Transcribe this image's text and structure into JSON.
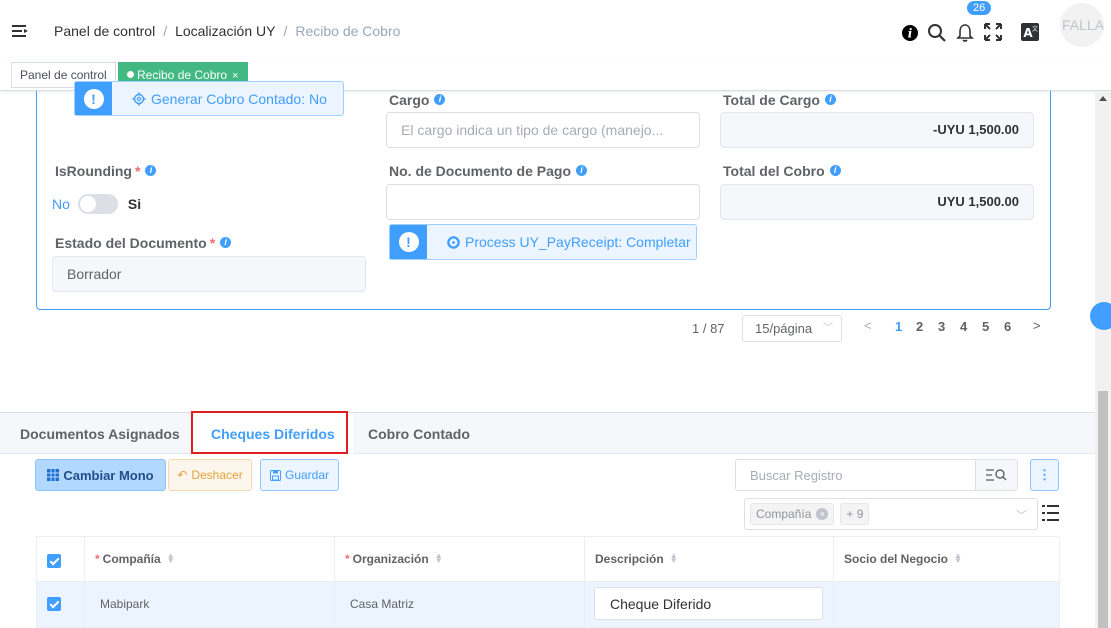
{
  "header": {
    "breadcrumbs": [
      "Panel de control",
      "Localización UY",
      "Recibo de Cobro"
    ],
    "notification_count": "26",
    "avatar_text": "FALLA"
  },
  "tags": {
    "items": [
      {
        "label": "Panel de control"
      },
      {
        "label": "Recibo de Cobro",
        "close": "×"
      }
    ]
  },
  "form": {
    "generar_cobro_btn": "Generar Cobro Contado: No",
    "cargo_label": "Cargo",
    "cargo_placeholder": "El cargo indica un tipo de cargo (manejo...",
    "total_cargo_label": "Total de Cargo",
    "total_cargo_value": "-UYU 1,500.00",
    "isrounding_label": "IsRounding",
    "switch_no": "No",
    "switch_si": "Si",
    "no_documento_label": "No. de Documento de Pago",
    "no_documento_value": "",
    "total_cobro_label": "Total del Cobro",
    "total_cobro_value": "UYU 1,500.00",
    "process_btn": "Process UY_PayReceipt: Completar",
    "estado_label": "Estado del Documento",
    "estado_value": "Borrador",
    "required_mark": "*"
  },
  "pagination": {
    "position": "1 / 87",
    "page_size": "15/página",
    "pages": [
      "1",
      "2",
      "3",
      "4",
      "5",
      "6"
    ],
    "current": "1",
    "prev": "<",
    "next": ">"
  },
  "tabs": [
    {
      "label": "Documentos Asignados"
    },
    {
      "label": "Cheques Diferidos"
    },
    {
      "label": "Cobro Contado"
    }
  ],
  "toolbar": {
    "cambiar_mono": "Cambiar Mono",
    "deshacer": "Deshacer",
    "guardar": "Guardar",
    "search_placeholder": "Buscar Registro",
    "column_chip": "Compañía",
    "column_more": "+ 9"
  },
  "table": {
    "columns": [
      "Compañía",
      "Organización",
      "Descripción",
      "Socio del Negocio"
    ],
    "rows": [
      {
        "compania": "Mabipark",
        "organizacion": "Casa Matriz",
        "descripcion": "Cheque Diferido",
        "socio": ""
      }
    ]
  },
  "colors": {
    "primary": "#409eff",
    "active_tag": "#42b983",
    "warning": "#e6a23c",
    "highlight_outline": "#e02020"
  }
}
